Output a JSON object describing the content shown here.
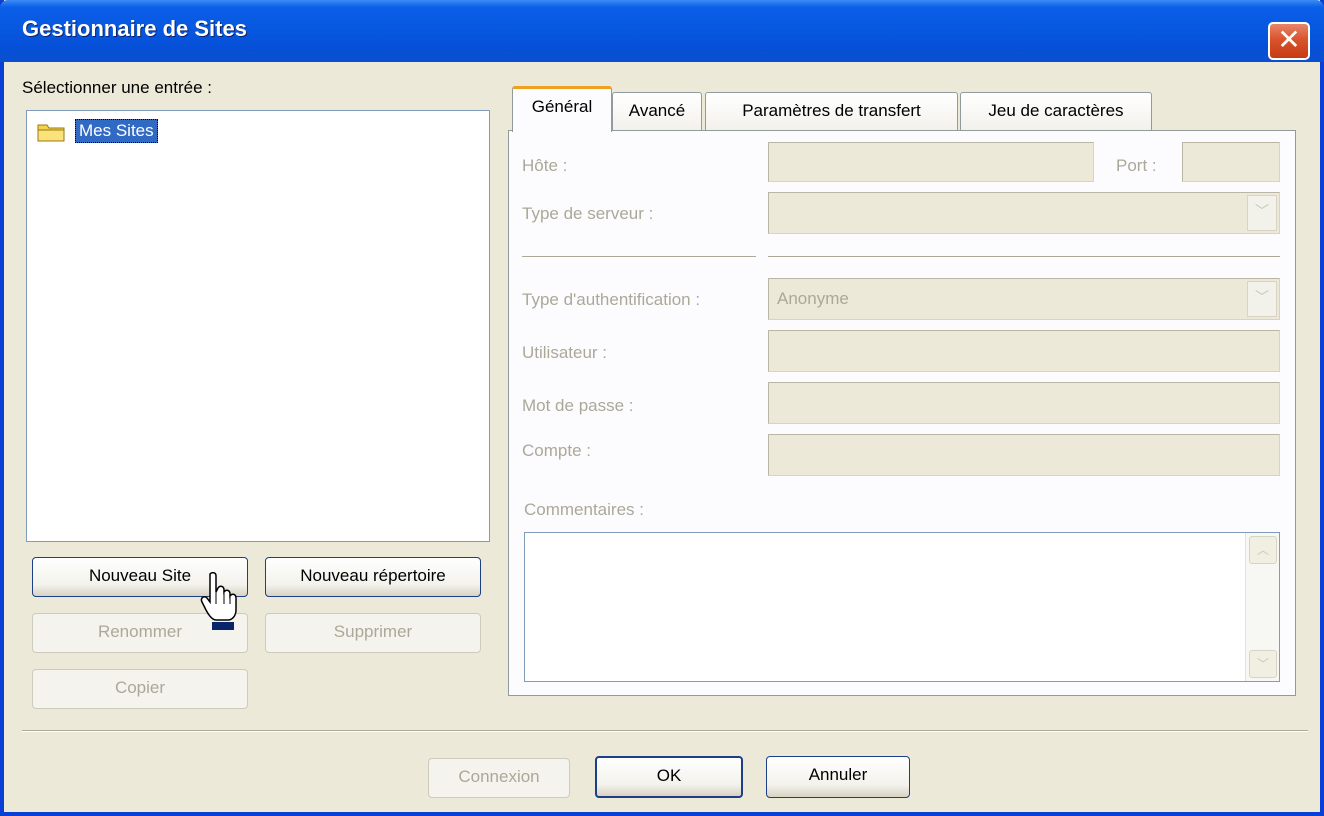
{
  "window": {
    "title": "Gestionnaire de Sites",
    "close_glyph": "✕"
  },
  "left": {
    "select_label": "Sélectionner une entrée :",
    "tree": [
      {
        "label": "Mes Sites",
        "icon": "folder-icon",
        "selected": true
      }
    ],
    "buttons": {
      "new_site": "Nouveau Site",
      "new_folder": "Nouveau répertoire",
      "rename": "Renommer",
      "delete": "Supprimer",
      "copy": "Copier"
    }
  },
  "tabs": [
    {
      "label": "Général",
      "active": true
    },
    {
      "label": "Avancé",
      "active": false
    },
    {
      "label": "Paramètres de transfert",
      "active": false
    },
    {
      "label": "Jeu de caractères",
      "active": false
    }
  ],
  "general": {
    "host_label": "Hôte :",
    "host_value": "",
    "port_label": "Port :",
    "port_value": "",
    "server_type_label": "Type de serveur :",
    "server_type_value": "",
    "auth_type_label": "Type d'authentification :",
    "auth_type_value": "Anonyme",
    "user_label": "Utilisateur :",
    "user_value": "",
    "password_label": "Mot de passe :",
    "password_value": "",
    "account_label": "Compte :",
    "account_value": "",
    "comments_label": "Commentaires :",
    "comments_value": ""
  },
  "footer": {
    "connect": "Connexion",
    "ok": "OK",
    "cancel": "Annuler"
  },
  "colors": {
    "titlebar": "#0858e0",
    "selection": "#316ac5",
    "disabled_text": "#aca899",
    "dialog_bg": "#ece9d8"
  }
}
